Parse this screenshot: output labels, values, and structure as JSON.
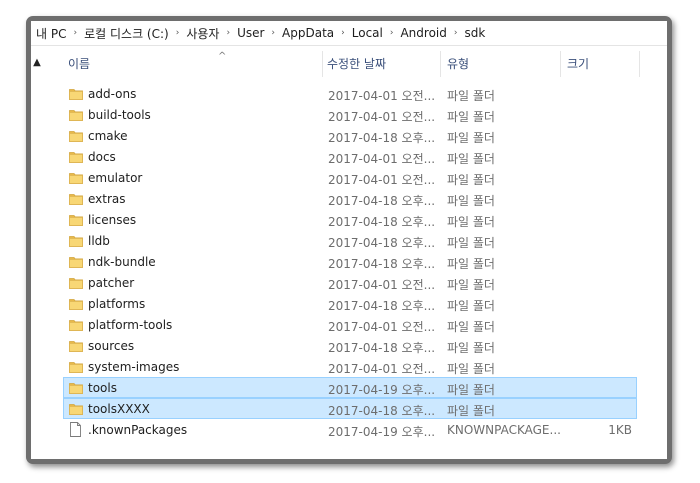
{
  "breadcrumb": [
    "내 PC",
    "로컬 디스크 (C:)",
    "사용자",
    "User",
    "AppData",
    "Local",
    "Android",
    "sdk"
  ],
  "columns": {
    "name": "이름",
    "date": "수정한 날짜",
    "type": "유형",
    "size": "크기"
  },
  "rows": [
    {
      "name": "add-ons",
      "date": "2017-04-01 오전...",
      "type": "파일 폴더",
      "size": "",
      "kind": "folder",
      "selected": false
    },
    {
      "name": "build-tools",
      "date": "2017-04-01 오전...",
      "type": "파일 폴더",
      "size": "",
      "kind": "folder",
      "selected": false
    },
    {
      "name": "cmake",
      "date": "2017-04-18 오후...",
      "type": "파일 폴더",
      "size": "",
      "kind": "folder",
      "selected": false
    },
    {
      "name": "docs",
      "date": "2017-04-01 오전...",
      "type": "파일 폴더",
      "size": "",
      "kind": "folder",
      "selected": false
    },
    {
      "name": "emulator",
      "date": "2017-04-01 오전...",
      "type": "파일 폴더",
      "size": "",
      "kind": "folder",
      "selected": false
    },
    {
      "name": "extras",
      "date": "2017-04-18 오후...",
      "type": "파일 폴더",
      "size": "",
      "kind": "folder",
      "selected": false
    },
    {
      "name": "licenses",
      "date": "2017-04-18 오후...",
      "type": "파일 폴더",
      "size": "",
      "kind": "folder",
      "selected": false
    },
    {
      "name": "lldb",
      "date": "2017-04-18 오후...",
      "type": "파일 폴더",
      "size": "",
      "kind": "folder",
      "selected": false
    },
    {
      "name": "ndk-bundle",
      "date": "2017-04-18 오후...",
      "type": "파일 폴더",
      "size": "",
      "kind": "folder",
      "selected": false
    },
    {
      "name": "patcher",
      "date": "2017-04-01 오전...",
      "type": "파일 폴더",
      "size": "",
      "kind": "folder",
      "selected": false
    },
    {
      "name": "platforms",
      "date": "2017-04-18 오후...",
      "type": "파일 폴더",
      "size": "",
      "kind": "folder",
      "selected": false
    },
    {
      "name": "platform-tools",
      "date": "2017-04-01 오전...",
      "type": "파일 폴더",
      "size": "",
      "kind": "folder",
      "selected": false
    },
    {
      "name": "sources",
      "date": "2017-04-18 오후...",
      "type": "파일 폴더",
      "size": "",
      "kind": "folder",
      "selected": false
    },
    {
      "name": "system-images",
      "date": "2017-04-01 오전...",
      "type": "파일 폴더",
      "size": "",
      "kind": "folder",
      "selected": false
    },
    {
      "name": "tools",
      "date": "2017-04-19 오후...",
      "type": "파일 폴더",
      "size": "",
      "kind": "folder",
      "selected": true
    },
    {
      "name": "toolsXXXX",
      "date": "2017-04-18 오후...",
      "type": "파일 폴더",
      "size": "",
      "kind": "folder",
      "selected": true
    },
    {
      "name": ".knownPackages",
      "date": "2017-04-19 오후...",
      "type": "KNOWNPACKAGE...",
      "size": "1KB",
      "kind": "file",
      "selected": false
    }
  ],
  "colors": {
    "selection_bg": "#cce8ff",
    "selection_border": "#99d1ff",
    "folder": "#f8d775",
    "header_text": "#3a4f7a"
  },
  "icons": {
    "folder": "folder-icon",
    "file": "file-icon",
    "collapse": "chevron-up-icon",
    "separator": "chevron-right-icon"
  }
}
